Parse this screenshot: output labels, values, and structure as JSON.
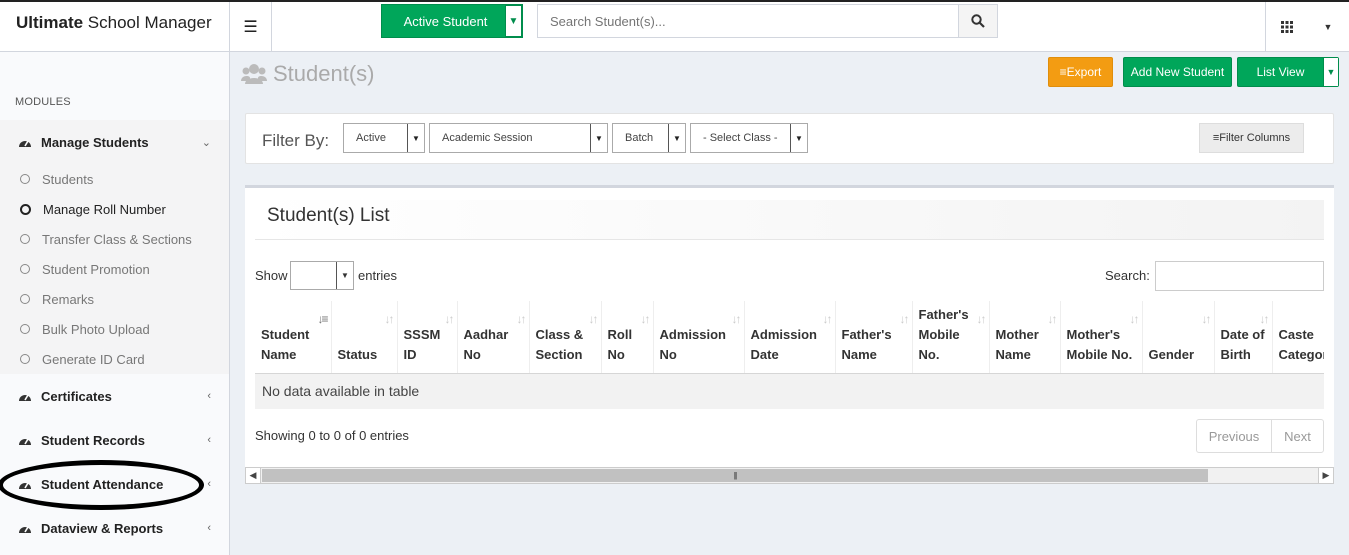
{
  "brand": {
    "bold": "Ultimate",
    "rest": " School Manager"
  },
  "topbar": {
    "active_student_label": "Active Student",
    "search_placeholder": "Search Student(s)..."
  },
  "sidebar": {
    "modules_label": "MODULES",
    "manage_students": "Manage Students",
    "sub_items": [
      "Students",
      "Manage Roll Number",
      "Transfer Class & Sections",
      "Student Promotion",
      "Remarks",
      "Bulk Photo Upload",
      "Generate ID Card"
    ],
    "certificates": "Certificates",
    "student_records": "Student Records",
    "student_attendance": "Student Attendance",
    "dataview_reports": "Dataview & Reports"
  },
  "page": {
    "title": "Student(s)",
    "export_label": "Export",
    "add_new_label": "Add New Student",
    "list_view_label": "List View"
  },
  "filter": {
    "label": "Filter By:",
    "status": "Active",
    "session": "Academic Session",
    "batch": "Batch",
    "class": "- Select Class -",
    "filter_columns": "Filter Columns"
  },
  "list": {
    "title": "Student(s) List",
    "show": "Show",
    "entries": "entries",
    "search": "Search:",
    "columns": [
      "Student Name",
      "Status",
      "SSSM ID",
      "Aadhar No",
      "Class & Section",
      "Roll No",
      "Admission No",
      "Admission Date",
      "Father's Name",
      "Father's Mobile No.",
      "Mother Name",
      "Mother's Mobile No.",
      "Gender",
      "Date of Birth",
      "Caste Category"
    ],
    "empty_message": "No data available in table",
    "info": "Showing 0 to 0 of 0 entries",
    "previous": "Previous",
    "next": "Next"
  },
  "colors": {
    "green": "#00a65a",
    "orange": "#f39c12"
  }
}
